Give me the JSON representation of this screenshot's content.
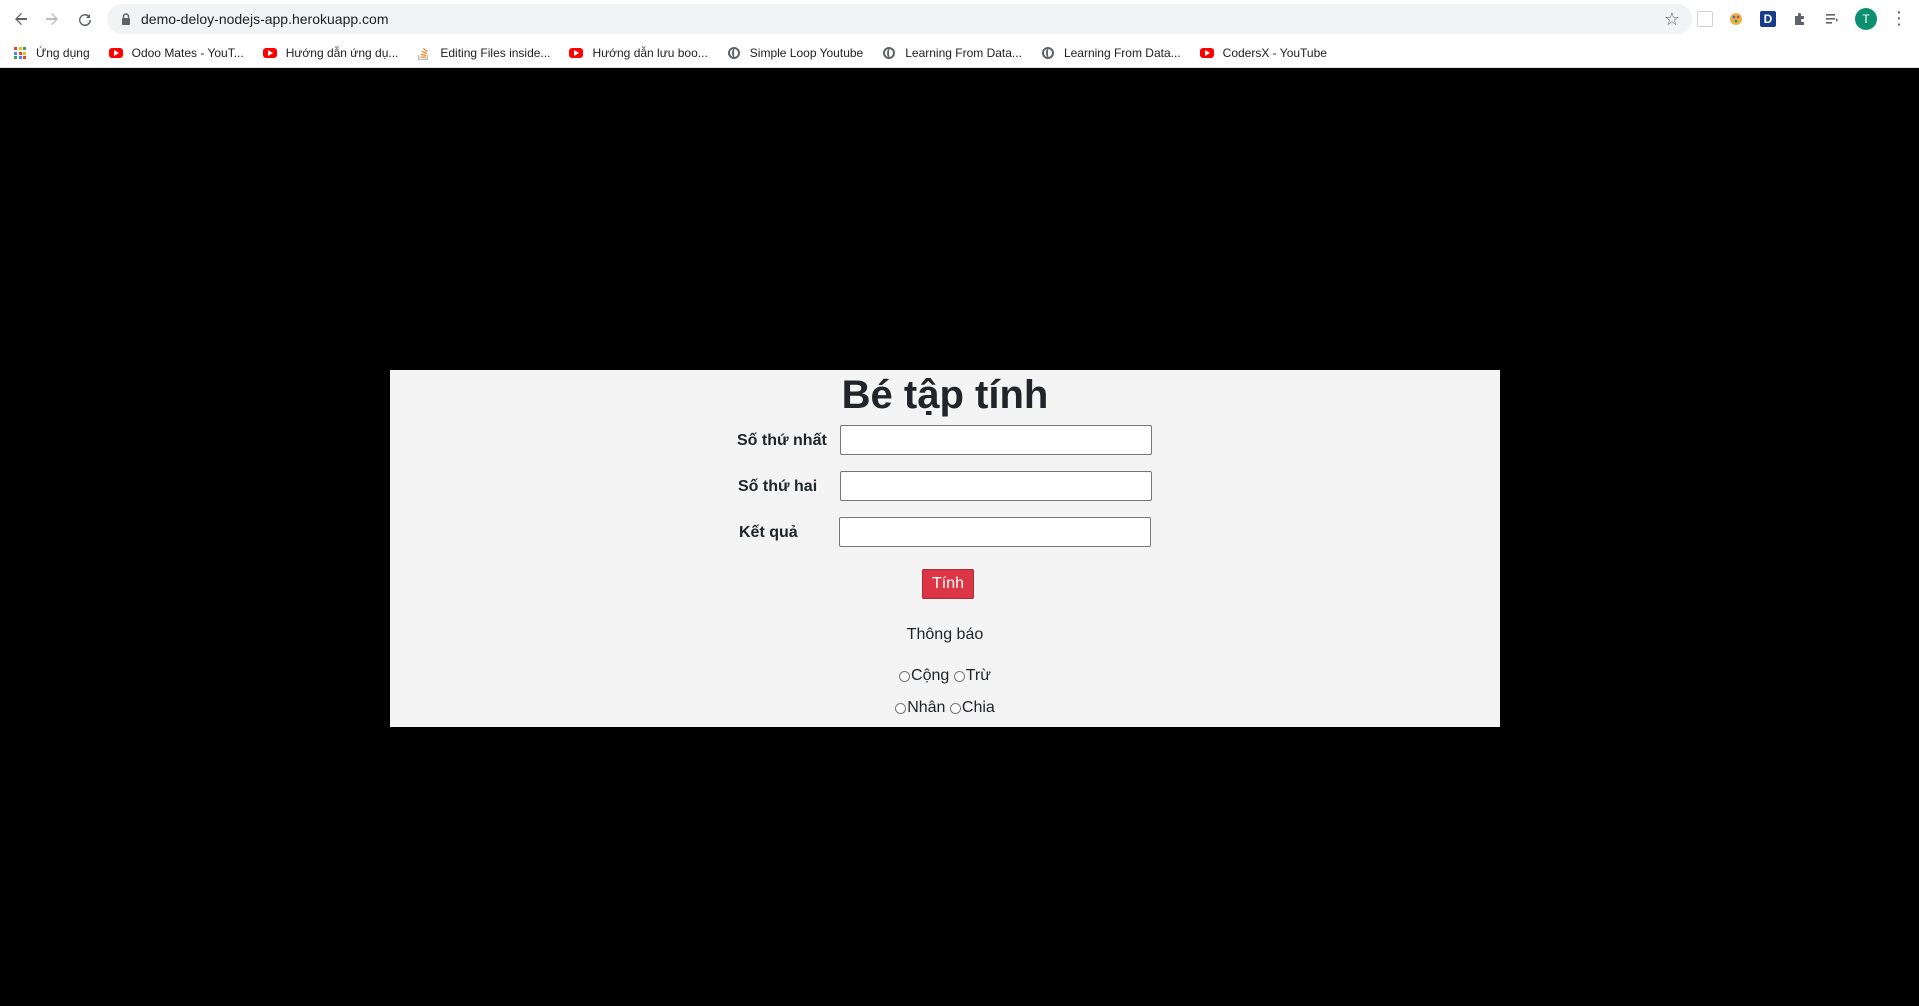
{
  "browser": {
    "url": "demo-deloy-nodejs-app.herokuapp.com",
    "avatar_letter": "T",
    "ext_d_letter": "D",
    "bookmarks": [
      {
        "label": "Ứng dụng",
        "icon": "apps-grid-icon"
      },
      {
        "label": "Odoo Mates - YouT...",
        "icon": "youtube-icon"
      },
      {
        "label": "Hướng dẫn ứng dụ...",
        "icon": "youtube-icon"
      },
      {
        "label": "Editing Files inside...",
        "icon": "stackoverflow-icon"
      },
      {
        "label": "Hướng dẫn lưu boo...",
        "icon": "youtube-icon"
      },
      {
        "label": "Simple Loop Youtube",
        "icon": "globe-icon"
      },
      {
        "label": "Learning From Data...",
        "icon": "globe-icon"
      },
      {
        "label": "Learning From Data...",
        "icon": "globe-icon"
      },
      {
        "label": "CodersX - YouTube",
        "icon": "youtube-icon"
      }
    ]
  },
  "page": {
    "title": "Bé tập tính",
    "fields": [
      {
        "label": "Số thứ nhất",
        "value": "",
        "placeholder": ""
      },
      {
        "label": "Số thứ hai",
        "value": "",
        "placeholder": ""
      },
      {
        "label": "Kết quả",
        "value": "",
        "placeholder": ""
      }
    ],
    "button_label": "Tính",
    "notice": "Thông báo",
    "operations": [
      "Cộng",
      "Trừ",
      "Nhân",
      "Chia"
    ]
  },
  "colors": {
    "background": "#000000",
    "panel": "#f4f4f4",
    "button": "#dc3545",
    "avatar": "#0b8f6f"
  }
}
